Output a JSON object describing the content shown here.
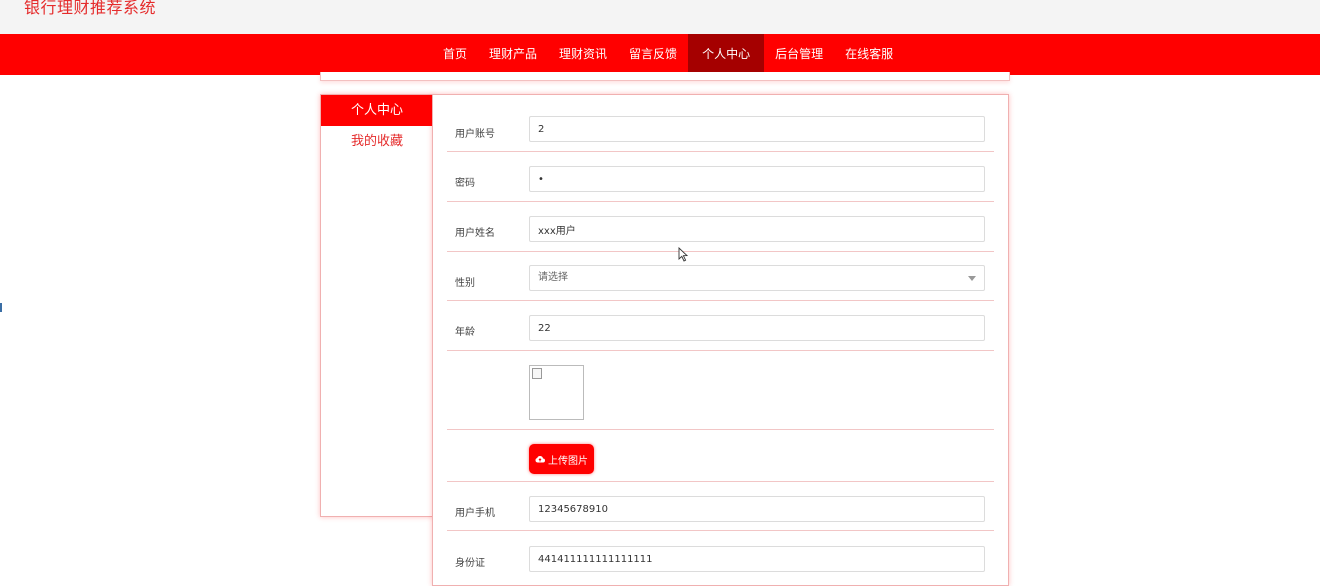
{
  "app": {
    "title": "银行理财推荐系统"
  },
  "nav": {
    "items": [
      "首页",
      "理财产品",
      "理财资讯",
      "留言反馈",
      "个人中心",
      "后台管理",
      "在线客服"
    ],
    "active": "个人中心"
  },
  "sidebar": {
    "items": [
      {
        "label": "个人中心",
        "active": true
      },
      {
        "label": "我的收藏",
        "active": false
      }
    ]
  },
  "form": {
    "account": {
      "label": "用户账号",
      "value": "2"
    },
    "password": {
      "label": "密码",
      "value": "•"
    },
    "name": {
      "label": "用户姓名",
      "value": "xxx用户"
    },
    "gender": {
      "label": "性别",
      "placeholder": "请选择",
      "value": ""
    },
    "age": {
      "label": "年龄",
      "value": "22"
    },
    "avatar": {
      "label": "",
      "upload_label": "上传图片",
      "upload_icon": "cloud-upload-icon"
    },
    "phone": {
      "label": "用户手机",
      "value": "12345678910"
    },
    "id_card": {
      "label": "身份证",
      "value": "441411111111111111"
    }
  },
  "colors": {
    "brand": "#ff0000",
    "nav_active": "#a50000",
    "title": "#e52c2c"
  }
}
